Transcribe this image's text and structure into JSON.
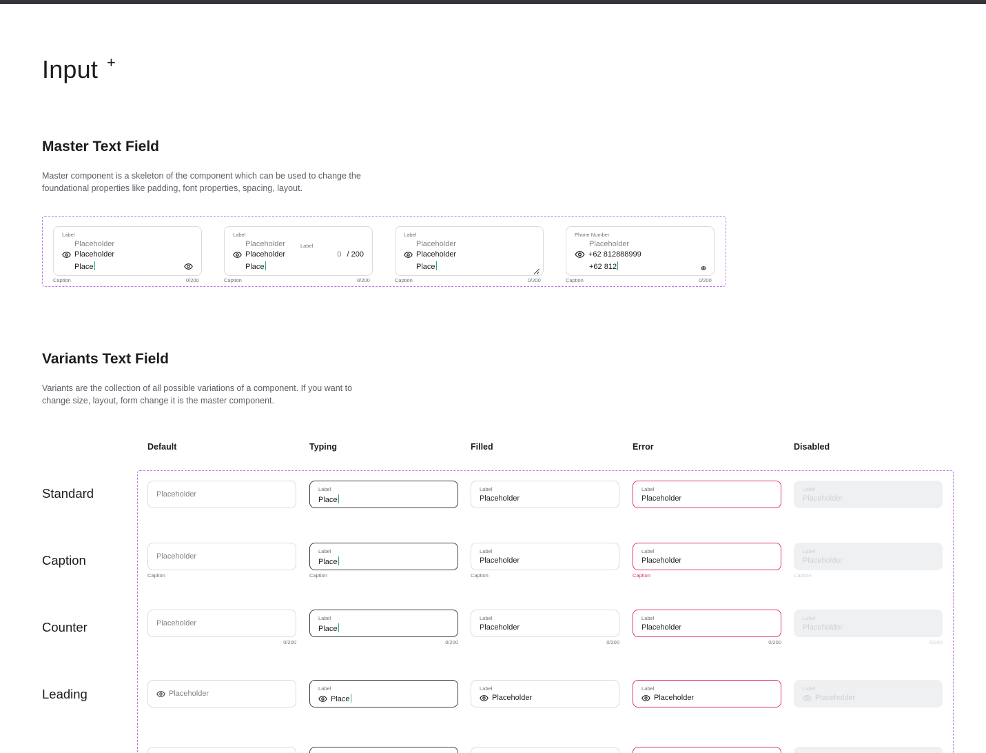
{
  "page": {
    "title": "Input",
    "title_mark": "+"
  },
  "master": {
    "title": "Master Text Field",
    "description": "Master component is a skeleton of the component which can be used to change the foundational properties like padding, font properties, spacing, layout.",
    "fields": [
      {
        "label": "Label",
        "placeholder": "Placeholder",
        "eye_value": "Placeholder",
        "typed": "Place",
        "caption": "Caption",
        "count": "0/200"
      },
      {
        "label": "Label",
        "placeholder": "Placeholder",
        "eye_value": "Placeholder",
        "typed": "Place",
        "inner_label": "Label",
        "counter_zero": "0",
        "counter_max": "/ 200",
        "caption": "Caption",
        "count": "0/200"
      },
      {
        "label": "Label",
        "placeholder": "Placeholder",
        "eye_value": "Placeholder",
        "typed": "Place",
        "caption": "Caption",
        "count": "0/200"
      },
      {
        "label": "Phone Number",
        "placeholder": "Placeholder",
        "eye_value": "+62 812888999",
        "typed": "+62 812",
        "caption": "Caption",
        "count": "0/200"
      }
    ]
  },
  "variants": {
    "title": "Variants Text Field",
    "description": "Variants are the collection of all possible variations of a component. If you want to change size, layout, form change it is the master component.",
    "columns": [
      "Default",
      "Typing",
      "Filled",
      "Error",
      "Disabled"
    ],
    "rows": [
      "Standard",
      "Caption",
      "Counter",
      "Leading"
    ],
    "label": "Label",
    "placeholder": "Placeholder",
    "typed": "Place",
    "caption": "Caption",
    "count": "0/200"
  },
  "colors": {
    "accent_dash": "#b779e8",
    "error": "#e0336a",
    "caret": "#26a69a",
    "typing_border": "#3b3d42"
  }
}
